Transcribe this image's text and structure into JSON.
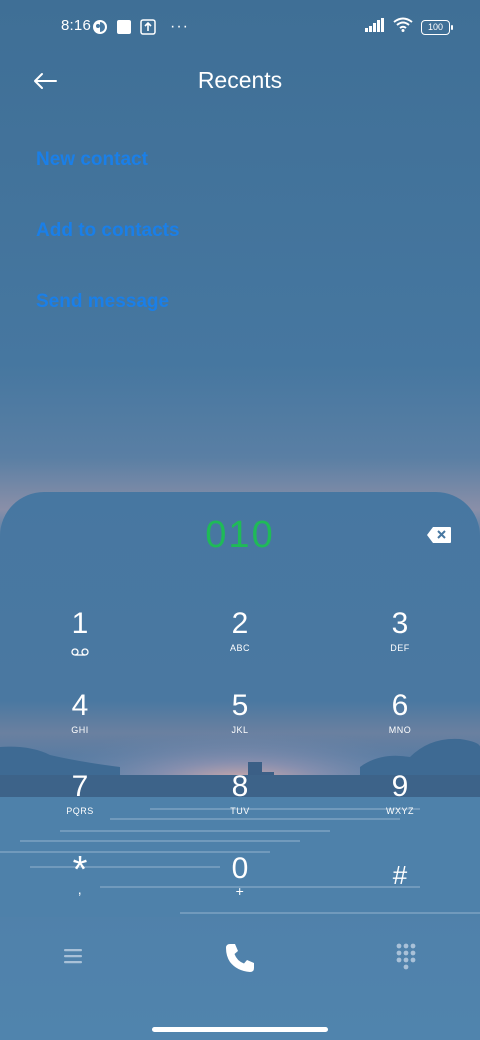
{
  "status_bar": {
    "time": "8:16",
    "more": "···",
    "battery": "100",
    "icons": [
      "app-notification-icon",
      "square-notification-icon",
      "upload-notification-icon",
      "signal-icon",
      "wifi-icon",
      "battery-icon"
    ]
  },
  "header": {
    "title": "Recents",
    "back_icon": "back-arrow-icon"
  },
  "actions": [
    {
      "label": "New contact"
    },
    {
      "label": "Add to contacts"
    },
    {
      "label": "Send message"
    }
  ],
  "accent_colors": {
    "action_link": "#1a7fe8",
    "dialed_number": "#1fba58"
  },
  "dialer": {
    "number": "010",
    "keys": [
      {
        "digit": "1",
        "letters": ""
      },
      {
        "digit": "2",
        "letters": "ABC"
      },
      {
        "digit": "3",
        "letters": "DEF"
      },
      {
        "digit": "4",
        "letters": "GHI"
      },
      {
        "digit": "5",
        "letters": "JKL"
      },
      {
        "digit": "6",
        "letters": "MNO"
      },
      {
        "digit": "7",
        "letters": "PQRS"
      },
      {
        "digit": "8",
        "letters": "TUV"
      },
      {
        "digit": "9",
        "letters": "WXYZ"
      },
      {
        "digit": "*",
        "letters": ","
      },
      {
        "digit": "0",
        "letters": "+"
      },
      {
        "digit": "#",
        "letters": ""
      }
    ]
  },
  "bottom_bar": {
    "icons": [
      "menu-icon",
      "call-icon",
      "dialpad-icon"
    ]
  }
}
